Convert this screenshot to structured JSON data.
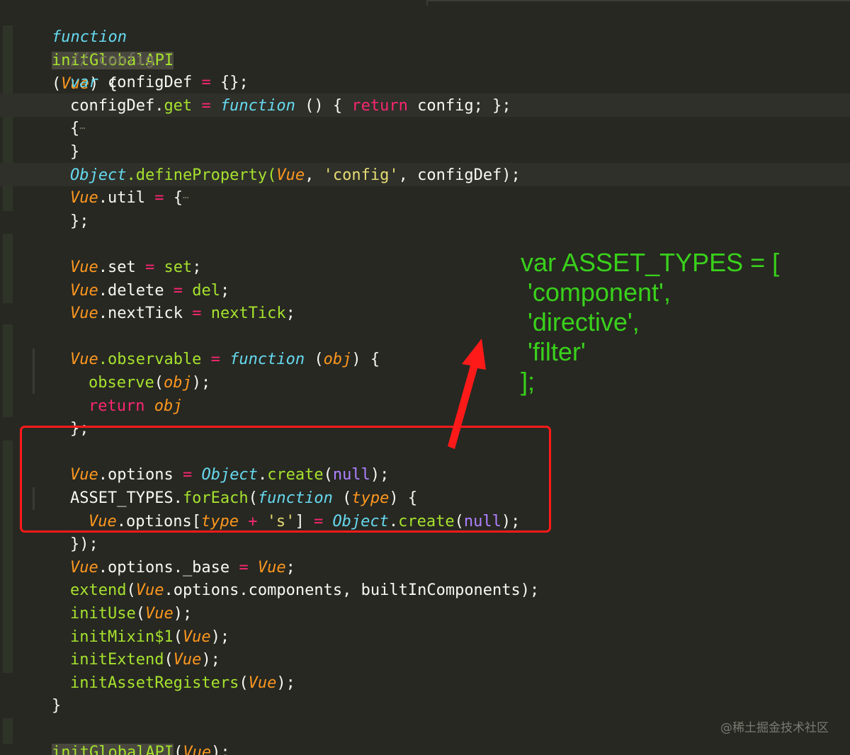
{
  "code": {
    "l1": [
      "function",
      "initGlobalAPI",
      "(",
      "Vue",
      ") {"
    ],
    "l2": "// config",
    "l3": [
      "var",
      "configDef",
      "=",
      "{};"
    ],
    "l4": [
      "configDef.",
      "get",
      "=",
      "function",
      "() {",
      "return",
      "config; };"
    ],
    "l5": "{",
    "l6": "}",
    "l7": [
      "Object",
      ".defineProperty(",
      "Vue",
      ",",
      "'config'",
      ", configDef);"
    ],
    "l8": [
      "Vue",
      ".util",
      "=",
      "{"
    ],
    "l9": "};",
    "l10": [
      "Vue",
      ".set",
      "=",
      "set",
      ";"
    ],
    "l11": [
      "Vue",
      ".delete",
      "=",
      "del",
      ";"
    ],
    "l12": [
      "Vue",
      ".nextTick",
      "=",
      "nextTick",
      ";"
    ],
    "l13": [
      "Vue",
      ".observable",
      "=",
      "function",
      "(",
      "obj",
      ") {"
    ],
    "l14": [
      "observe",
      "(",
      "obj",
      ");"
    ],
    "l15": [
      "return",
      "obj"
    ],
    "l16": "};",
    "l17": [
      "Vue",
      ".options",
      "=",
      "Object",
      ".",
      "create",
      "(",
      "null",
      ");"
    ],
    "l18": [
      "ASSET_TYPES.",
      "forEach",
      "(",
      "function",
      "(",
      "type",
      ") {"
    ],
    "l19": [
      "Vue",
      ".options[",
      "type",
      "+",
      "'s'",
      "]",
      "=",
      "Object",
      ".",
      "create",
      "(",
      "null",
      ");"
    ],
    "l20": "});",
    "l21": [
      "Vue",
      ".options._base",
      "=",
      "Vue",
      ";"
    ],
    "l22": [
      "extend",
      "(",
      "Vue",
      ".options.components, builtInComponents);"
    ],
    "l23": [
      "initUse",
      "(",
      "Vue",
      ");"
    ],
    "l24": [
      "initMixin$1",
      "(",
      "Vue",
      ");"
    ],
    "l25": [
      "initExtend",
      "(",
      "Vue",
      ");"
    ],
    "l26": [
      "initAssetRegisters",
      "(",
      "Vue",
      ");"
    ],
    "l27": "}",
    "l28": [
      "initGlobalAPI",
      "(",
      "Vue",
      ");"
    ]
  },
  "annotation": {
    "text": "var ASSET_TYPES = [\n 'component',\n 'directive',\n 'filter'\n];",
    "color": "#39d11b"
  },
  "highlight_box_color": "#ff1a1a",
  "ellipsis": "⋯",
  "watermark": "@稀土掘金技术社区"
}
